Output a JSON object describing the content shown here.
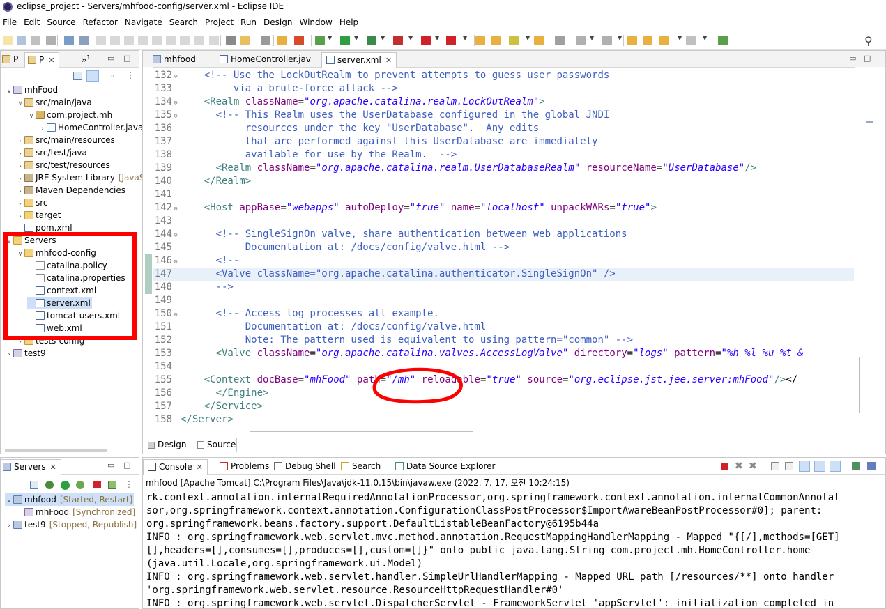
{
  "window": {
    "title": "eclipse_project - Servers/mhfood-config/server.xml - Eclipse IDE"
  },
  "menu": [
    "File",
    "Edit",
    "Source",
    "Refactor",
    "Navigate",
    "Search",
    "Project",
    "Run",
    "Design",
    "Window",
    "Help"
  ],
  "explorer": {
    "tabs": [
      "P",
      "P",
      "»",
      "1"
    ],
    "tree": [
      {
        "label": "mhFood",
        "icon": "project-icon",
        "twisty": "∨",
        "indent": 0,
        "decor": ""
      },
      {
        "label": "src/main/java",
        "icon": "package-folder-icon",
        "twisty": "∨",
        "indent": 1,
        "decor": ""
      },
      {
        "label": "com.project.mh",
        "icon": "package-icon",
        "twisty": "∨",
        "indent": 2,
        "decor": ""
      },
      {
        "label": "HomeController.java",
        "icon": "java-file-icon",
        "twisty": "›",
        "indent": 3,
        "decor": ""
      },
      {
        "label": "src/main/resources",
        "icon": "package-folder-icon",
        "twisty": "›",
        "indent": 1,
        "decor": ""
      },
      {
        "label": "src/test/java",
        "icon": "package-folder-icon",
        "twisty": "›",
        "indent": 1,
        "decor": ""
      },
      {
        "label": "src/test/resources",
        "icon": "package-folder-icon",
        "twisty": "›",
        "indent": 1,
        "decor": ""
      },
      {
        "label": "JRE System Library",
        "icon": "library-icon",
        "twisty": "›",
        "indent": 1,
        "decor": "[JavaSE"
      },
      {
        "label": "Maven Dependencies",
        "icon": "library-icon",
        "twisty": "›",
        "indent": 1,
        "decor": ""
      },
      {
        "label": "src",
        "icon": "folder-icon",
        "twisty": "›",
        "indent": 1,
        "decor": ""
      },
      {
        "label": "target",
        "icon": "folder-icon",
        "twisty": "›",
        "indent": 1,
        "decor": ""
      },
      {
        "label": "pom.xml",
        "icon": "xml-file-icon",
        "twisty": "",
        "indent": 1,
        "decor": ""
      },
      {
        "label": "Servers",
        "icon": "folder-icon",
        "twisty": "∨",
        "indent": 0,
        "decor": ""
      },
      {
        "label": "mhfood-config",
        "icon": "folder-icon",
        "twisty": "∨",
        "indent": 1,
        "decor": ""
      },
      {
        "label": "catalina.policy",
        "icon": "file-icon",
        "twisty": "",
        "indent": 2,
        "decor": ""
      },
      {
        "label": "catalina.properties",
        "icon": "file-icon",
        "twisty": "",
        "indent": 2,
        "decor": ""
      },
      {
        "label": "context.xml",
        "icon": "xml-file-icon",
        "twisty": "",
        "indent": 2,
        "decor": ""
      },
      {
        "label": "server.xml",
        "icon": "xml-file-icon",
        "twisty": "",
        "indent": 2,
        "decor": "",
        "selected": true
      },
      {
        "label": "tomcat-users.xml",
        "icon": "xml-file-icon",
        "twisty": "",
        "indent": 2,
        "decor": ""
      },
      {
        "label": "web.xml",
        "icon": "xml-file-icon",
        "twisty": "",
        "indent": 2,
        "decor": ""
      },
      {
        "label": "tests-config",
        "icon": "folder-icon",
        "twisty": "›",
        "indent": 1,
        "decor": ""
      },
      {
        "label": "test9",
        "icon": "project-icon",
        "twisty": "›",
        "indent": 0,
        "decor": ""
      }
    ]
  },
  "editor": {
    "tabs": [
      {
        "label": "mhfood",
        "active": false
      },
      {
        "label": "HomeController.jav",
        "active": false
      },
      {
        "label": "server.xml",
        "active": true
      }
    ],
    "bottom_tabs": [
      "Design",
      "Source"
    ],
    "lines": [
      {
        "n": "132",
        "fold": "⊖",
        "text": "    <!-- Use the LockOutRealm to prevent attempts to guess user passwords"
      },
      {
        "n": "133",
        "fold": "",
        "text": "         via a brute-force attack -->"
      },
      {
        "n": "134",
        "fold": "⊖",
        "text": "    <Realm className=\"org.apache.catalina.realm.LockOutRealm\">"
      },
      {
        "n": "135",
        "fold": "⊖",
        "text": "      <!-- This Realm uses the UserDatabase configured in the global JNDI"
      },
      {
        "n": "136",
        "fold": "",
        "text": "           resources under the key \"UserDatabase\".  Any edits"
      },
      {
        "n": "137",
        "fold": "",
        "text": "           that are performed against this UserDatabase are immediately"
      },
      {
        "n": "138",
        "fold": "",
        "text": "           available for use by the Realm.  -->"
      },
      {
        "n": "139",
        "fold": "",
        "text": "      <Realm className=\"org.apache.catalina.realm.UserDatabaseRealm\" resourceName=\"UserDatabase\"/>"
      },
      {
        "n": "140",
        "fold": "",
        "text": "    </Realm>"
      },
      {
        "n": "141",
        "fold": "",
        "text": ""
      },
      {
        "n": "142",
        "fold": "⊖",
        "text": "    <Host appBase=\"webapps\" autoDeploy=\"true\" name=\"localhost\" unpackWARs=\"true\">"
      },
      {
        "n": "143",
        "fold": "",
        "text": ""
      },
      {
        "n": "144",
        "fold": "⊖",
        "text": "      <!-- SingleSignOn valve, share authentication between web applications"
      },
      {
        "n": "145",
        "fold": "",
        "text": "           Documentation at: /docs/config/valve.html -->"
      },
      {
        "n": "146",
        "fold": "⊖",
        "text": "      <!--"
      },
      {
        "n": "147",
        "fold": "",
        "text": "      <Valve className=\"org.apache.catalina.authenticator.SingleSignOn\" />"
      },
      {
        "n": "148",
        "fold": "",
        "text": "      -->"
      },
      {
        "n": "149",
        "fold": "",
        "text": ""
      },
      {
        "n": "150",
        "fold": "⊖",
        "text": "      <!-- Access log processes all example."
      },
      {
        "n": "151",
        "fold": "",
        "text": "           Documentation at: /docs/config/valve.html"
      },
      {
        "n": "152",
        "fold": "",
        "text": "           Note: The pattern used is equivalent to using pattern=\"common\" -->"
      },
      {
        "n": "153",
        "fold": "",
        "text": "      <Valve className=\"org.apache.catalina.valves.AccessLogValve\" directory=\"logs\" pattern=\"%h %l %u %t &"
      },
      {
        "n": "154",
        "fold": "",
        "text": ""
      },
      {
        "n": "155",
        "fold": "",
        "text": "    <Context docBase=\"mhFood\" path=\"/mh\" reloadable=\"true\" source=\"org.eclipse.jst.jee.server:mhFood\"/></"
      },
      {
        "n": "156",
        "fold": "",
        "text": "      </Engine>"
      },
      {
        "n": "157",
        "fold": "",
        "text": "    </Service>"
      },
      {
        "n": "158",
        "fold": "",
        "text": "</Server>"
      }
    ]
  },
  "servers_view": {
    "tab": "Servers",
    "items": [
      {
        "label": "mhfood",
        "status": "[Started, Restart]",
        "indent": 0,
        "twisty": "∨",
        "selected": true
      },
      {
        "label": "mhFood",
        "status": "[Synchronized]",
        "indent": 1,
        "twisty": "",
        "selected": false
      },
      {
        "label": "test9",
        "status": "[Stopped, Republish]",
        "indent": 0,
        "twisty": "›",
        "selected": false
      }
    ]
  },
  "console": {
    "tabs": [
      "Console",
      "Problems",
      "Debug Shell",
      "Search",
      "Data Source Explorer"
    ],
    "header": "mhfood [Apache Tomcat] C:\\Program Files\\Java\\jdk-11.0.15\\bin\\javaw.exe  (2022. 7. 17. 오전 10:24:15)",
    "lines": [
      "rk.context.annotation.internalRequiredAnnotationProcessor,org.springframework.context.annotation.internalCommonAnnotat",
      "sor,org.springframework.context.annotation.ConfigurationClassPostProcessor$ImportAwareBeanPostProcessor#0]; parent:",
      "org.springframework.beans.factory.support.DefaultListableBeanFactory@6195b44a",
      "INFO : org.springframework.web.servlet.mvc.method.annotation.RequestMappingHandlerMapping - Mapped \"{[/],methods=[GET]",
      "[],headers=[],consumes=[],produces=[],custom=[]}\" onto public java.lang.String com.project.mh.HomeController.home",
      "(java.util.Locale,org.springframework.ui.Model)",
      "INFO : org.springframework.web.servlet.handler.SimpleUrlHandlerMapping - Mapped URL path [/resources/**] onto handler",
      "'org.springframework.web.servlet.resource.ResourceHttpRequestHandler#0'",
      "INFO : org.springframework.web.servlet.DispatcherServlet - FrameworkServlet 'appServlet': initialization completed in"
    ]
  },
  "colors": {
    "annotation_red": "#ff0000",
    "comment": "#3f5fbf",
    "tag": "#3f7f7f",
    "attribute": "#7f007f",
    "value": "#2a00ff"
  }
}
